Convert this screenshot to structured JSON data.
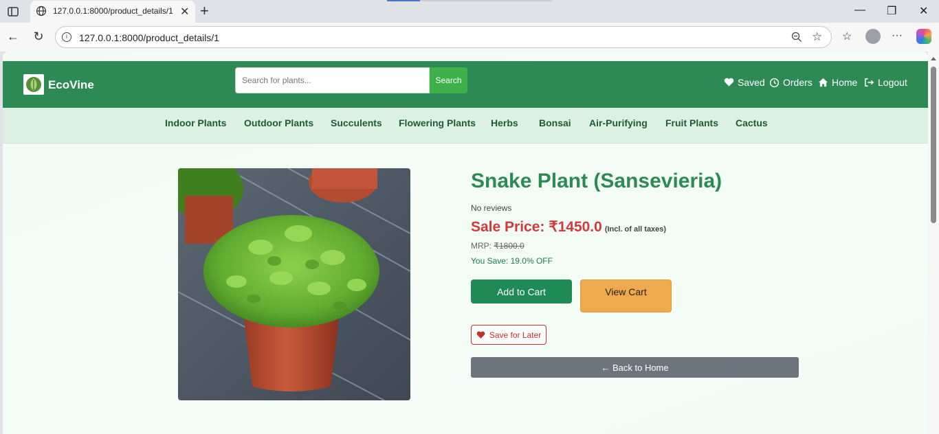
{
  "browser": {
    "tab_title": "127.0.0.1:8000/product_details/1",
    "url": "127.0.0.1:8000/product_details/1"
  },
  "header": {
    "brand": "EcoVine",
    "search_placeholder": "Search for plants...",
    "search_button": "Search",
    "nav": [
      {
        "label": "Saved",
        "icon": "heart-icon"
      },
      {
        "label": "Orders",
        "icon": "clock-icon"
      },
      {
        "label": "Home",
        "icon": "home-icon"
      },
      {
        "label": "Logout",
        "icon": "logout-icon"
      }
    ]
  },
  "categories": [
    "Indoor Plants",
    "Outdoor Plants",
    "Succulents",
    "Flowering Plants",
    "Herbs",
    "Bonsai",
    "Air-Purifying",
    "Fruit Plants",
    "Cactus"
  ],
  "product": {
    "title": "Snake Plant (Sansevieria)",
    "reviews": "No reviews",
    "sale_price": "Sale Price: ₹1450.0",
    "tax_note": "(Incl. of all taxes)",
    "mrp_label": "MRP:",
    "mrp_value": "₹1800.0",
    "you_save": "You Save: 19.0% OFF",
    "add_to_cart": "Add to Cart",
    "view_cart": "View Cart",
    "save_for_later": "Save for Later",
    "back_home": "← Back to Home"
  },
  "colors": {
    "header_green": "#2e8a55",
    "category_bar": "#ddf1e2",
    "sale_red": "#d13a3a",
    "view_cart_orange": "#eeaa4c",
    "back_gray": "#6c757d"
  }
}
